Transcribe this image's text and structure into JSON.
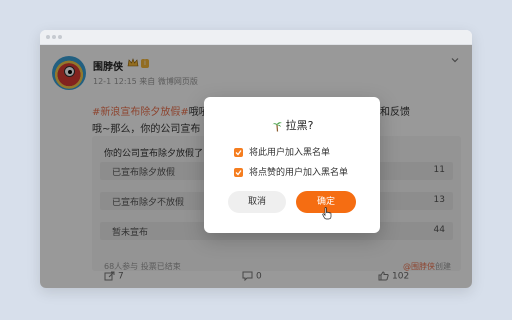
{
  "post": {
    "username": "围脖侠",
    "level_badge": "i",
    "meta": "12-1 12:15  来自 微博网页版",
    "line1_hashtag": "#新浪宣布除夕放假#",
    "line1_text": "哦吼",
    "line1_suffix": "意见建议和反馈",
    "line2_text": "哦~那么，你的公司宣布"
  },
  "poll": {
    "title": "你的公司宣布除夕放假了",
    "options": [
      {
        "label": "已宣布除夕放假",
        "count": "11"
      },
      {
        "label": "已宣布除夕不放假",
        "count": "13"
      },
      {
        "label": "暂未宣布",
        "count": "44"
      }
    ],
    "footer": "68人参与  投票已结束",
    "creator_mention": "@围脖侠",
    "creator_suffix": "创建"
  },
  "actions": {
    "share_count": "7",
    "comment_count": "0",
    "like_count": "102"
  },
  "dialog": {
    "title": "拉黑?",
    "option1": "将此用户加入黑名单",
    "option2": "将点赞的用户加入黑名单",
    "cancel_label": "取消",
    "confirm_label": "确定"
  },
  "colors": {
    "accent": "#f56d12",
    "hashtag": "#eb7350",
    "checkbox": "#f57d1f"
  },
  "icons": [
    "crown-icon",
    "chevron-down-icon",
    "share-icon",
    "comment-icon",
    "like-icon",
    "palm-tree-icon",
    "checkmark-icon",
    "hand-cursor-icon"
  ]
}
